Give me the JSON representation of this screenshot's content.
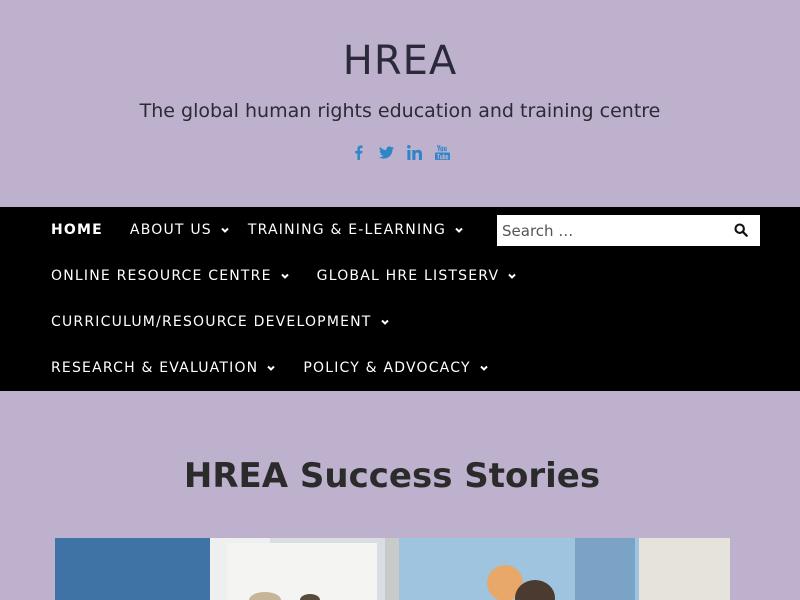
{
  "site": {
    "title": "HREA",
    "tagline": "The global human rights education and training centre"
  },
  "social": [
    {
      "name": "facebook-icon"
    },
    {
      "name": "twitter-icon"
    },
    {
      "name": "linkedin-icon"
    },
    {
      "name": "youtube-icon"
    }
  ],
  "nav": {
    "items": [
      {
        "label": "HOME"
      },
      {
        "label": "ABOUT US"
      },
      {
        "label": "TRAINING & E-LEARNING"
      },
      {
        "label": "ONLINE RESOURCE CENTRE"
      },
      {
        "label": "GLOBAL HRE LISTSERV"
      },
      {
        "label": "CURRICULUM/RESOURCE DEVELOPMENT"
      },
      {
        "label": "RESEARCH & EVALUATION"
      },
      {
        "label": "POLICY & ADVOCACY"
      }
    ]
  },
  "search": {
    "placeholder": "Search …"
  },
  "page": {
    "title": "HREA Success Stories"
  },
  "colors": {
    "background": "#bdb1ce",
    "nav_background": "#000000",
    "social_icon": "#2e86c9"
  }
}
